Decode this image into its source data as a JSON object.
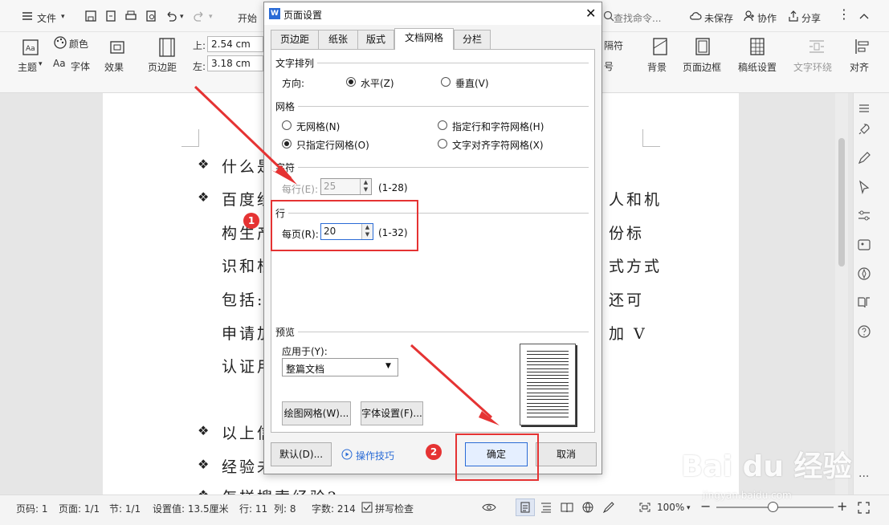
{
  "titlebar": {
    "file_menu": "文件",
    "start_tab": "开始",
    "search_placeholder": "查找命令...",
    "unsaved": "未保存",
    "collab": "协作",
    "share": "分享"
  },
  "ribbon": {
    "theme": "主题",
    "color": "颜色",
    "font": "字体",
    "effect": "效果",
    "margin": "页边距",
    "top_label": "上:",
    "top_value": "2.54 cm",
    "left_label": "左:",
    "left_value": "3.18 cm",
    "separator": "隔符",
    "number": "号",
    "background": "背景",
    "page_border": "页面边框",
    "manuscript": "稿纸设置",
    "text_wrap": "文字环绕",
    "align": "对齐"
  },
  "document": {
    "lines": [
      {
        "bullet": true,
        "text": "什么是"
      },
      {
        "bullet": true,
        "text": "百度经",
        "tail": "人和机"
      },
      {
        "bullet": false,
        "text": "构生产",
        "tail": "份标"
      },
      {
        "bullet": false,
        "text": "识和根",
        "tail": "式方式"
      },
      {
        "bullet": false,
        "text": "包括:",
        "tail": "还可"
      },
      {
        "bullet": false,
        "text": "申请加",
        "tail": "加 V"
      },
      {
        "bullet": false,
        "text": "认证用",
        "tail": ""
      },
      {
        "bullet": true,
        "text": "以上信"
      },
      {
        "bullet": true,
        "text": "经验未"
      },
      {
        "bullet": true,
        "text": "怎样搜索经验?"
      }
    ]
  },
  "dialog": {
    "title": "页面设置",
    "tabs": [
      "页边距",
      "纸张",
      "版式",
      "文档网格",
      "分栏"
    ],
    "active_tab": "文档网格",
    "text_direction_section": "文字排列",
    "direction_label": "方向:",
    "horizontal": "水平(Z)",
    "vertical": "垂直(V)",
    "grid_section": "网格",
    "no_grid": "无网格(N)",
    "line_char_grid": "指定行和字符网格(H)",
    "line_grid_only": "只指定行网格(O)",
    "text_align_grid": "文字对齐字符网格(X)",
    "char_section": "字符",
    "per_line_label": "每行(E):",
    "per_line_value": "25",
    "per_line_range": "(1-28)",
    "line_section": "行",
    "per_page_label": "每页(R):",
    "per_page_value": "20",
    "per_page_range": "(1-32)",
    "preview_section": "预览",
    "apply_to_label": "应用于(Y):",
    "apply_to_value": "整篇文档",
    "draw_grid_btn": "绘图网格(W)...",
    "font_settings_btn": "字体设置(F)...",
    "default_btn": "默认(D)...",
    "tips_link": "操作技巧",
    "ok_btn": "确定",
    "cancel_btn": "取消",
    "accent": "#2a6bd6"
  },
  "annotations": {
    "badge1": "1",
    "badge2": "2",
    "color": "#e53333"
  },
  "statusbar": {
    "page_code": "页码: 1",
    "page": "页面: 1/1",
    "section": "节: 1/1",
    "setting_value": "设置值: 13.5厘米",
    "row": "行: 11",
    "col": "列: 8",
    "word_count": "字数: 214",
    "spell_check": "拼写检查",
    "zoom": "100%"
  },
  "watermark": {
    "brand": "Bai du 经验",
    "url": "jingyan.baidu.com"
  }
}
